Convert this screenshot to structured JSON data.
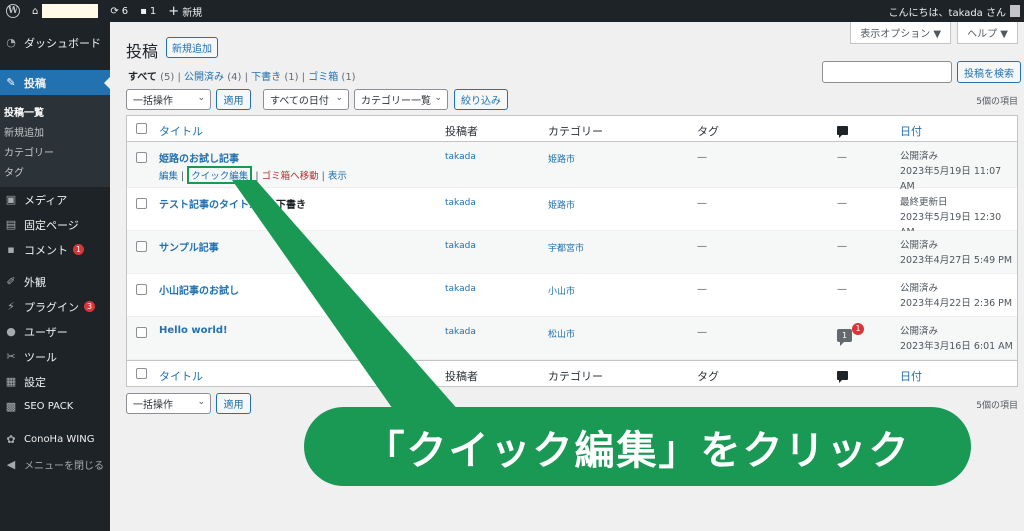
{
  "adminbar": {
    "updates_count": "6",
    "comments_count": "1",
    "new_label": "新規",
    "greeting": "こんにちは、takada さん"
  },
  "sidebar": {
    "dashboard": "ダッシュボード",
    "posts": "投稿",
    "posts_submenu": [
      "投稿一覧",
      "新規追加",
      "カテゴリー",
      "タグ"
    ],
    "media": "メディア",
    "pages": "固定ページ",
    "comments": "コメント",
    "comments_badge": "1",
    "appearance": "外観",
    "plugins": "プラグイン",
    "plugins_badge": "3",
    "users": "ユーザー",
    "tools": "ツール",
    "settings": "設定",
    "seo_pack": "SEO PACK",
    "conoha_wing": "ConoHa WING",
    "collapse": "メニューを閉じる"
  },
  "screen": {
    "options": "表示オプション ▼",
    "help": "ヘルプ ▼"
  },
  "page": {
    "title": "投稿",
    "add_new": "新規追加"
  },
  "filters": {
    "all_label": "すべて",
    "all_count": "(5)",
    "published_label": "公開済み",
    "published_count": "(4)",
    "drafts_label": "下書き",
    "drafts_count": "(1)",
    "trash_label": "ゴミ箱",
    "trash_count": "(1)",
    "sep": "|"
  },
  "search": {
    "button": "投稿を検索",
    "value": ""
  },
  "tablenav": {
    "bulk_actions": "一括操作",
    "apply": "適用",
    "all_dates": "すべての日付",
    "all_categories": "カテゴリー一覧",
    "filter": "絞り込み",
    "items_count": "5個の項目"
  },
  "columns": {
    "title": "タイトル",
    "author": "投稿者",
    "categories": "カテゴリー",
    "tags": "タグ",
    "date": "日付"
  },
  "row_actions": {
    "edit": "編集",
    "quick_edit": "クイック編集",
    "trash": "ゴミ箱へ移動",
    "view": "表示",
    "sep": "|"
  },
  "posts": [
    {
      "title": "姫路のお試し記事",
      "state": "",
      "author": "takada",
      "category": "姫路市",
      "tags": "—",
      "comments": "—",
      "date_status": "公開済み",
      "date": "2023年5月19日 11:07 AM"
    },
    {
      "title": "テスト記事のタイトル",
      "state": " — 下書き",
      "author": "takada",
      "category": "姫路市",
      "tags": "—",
      "comments": "—",
      "date_status": "最終更新日",
      "date": "2023年5月19日 12:30 AM"
    },
    {
      "title": "サンプル記事",
      "state": "",
      "author": "takada",
      "category": "宇都宮市",
      "tags": "—",
      "comments": "—",
      "date_status": "公開済み",
      "date": "2023年4月27日 5:49 PM"
    },
    {
      "title": "小山記事のお試し",
      "state": "",
      "author": "takada",
      "category": "小山市",
      "tags": "—",
      "comments": "—",
      "date_status": "公開済み",
      "date": "2023年4月22日 2:36 PM"
    },
    {
      "title": "Hello world!",
      "state": "",
      "author": "takada",
      "category": "松山市",
      "tags": "—",
      "comments": "1",
      "comments_pending": "1",
      "date_status": "公開済み",
      "date": "2023年3月16日 6:01 AM"
    }
  ],
  "callout": {
    "text": "「クイック編集」をクリック",
    "color": "#1a9955"
  }
}
